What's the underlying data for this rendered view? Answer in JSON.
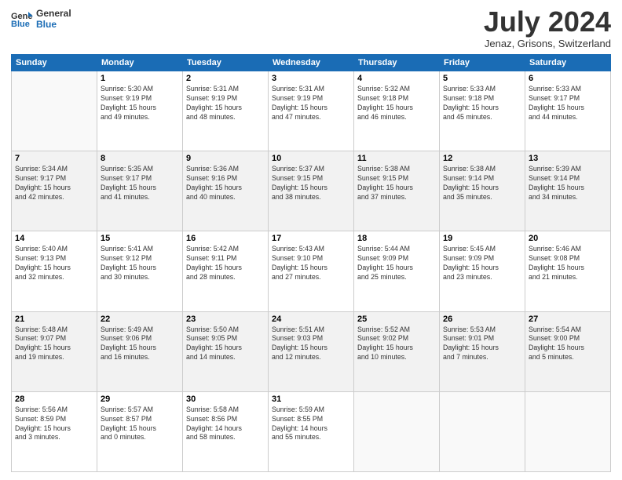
{
  "header": {
    "logo_line1": "General",
    "logo_line2": "Blue",
    "month_year": "July 2024",
    "location": "Jenaz, Grisons, Switzerland"
  },
  "weekdays": [
    "Sunday",
    "Monday",
    "Tuesday",
    "Wednesday",
    "Thursday",
    "Friday",
    "Saturday"
  ],
  "weeks": [
    [
      {
        "day": "",
        "info": ""
      },
      {
        "day": "1",
        "info": "Sunrise: 5:30 AM\nSunset: 9:19 PM\nDaylight: 15 hours\nand 49 minutes."
      },
      {
        "day": "2",
        "info": "Sunrise: 5:31 AM\nSunset: 9:19 PM\nDaylight: 15 hours\nand 48 minutes."
      },
      {
        "day": "3",
        "info": "Sunrise: 5:31 AM\nSunset: 9:19 PM\nDaylight: 15 hours\nand 47 minutes."
      },
      {
        "day": "4",
        "info": "Sunrise: 5:32 AM\nSunset: 9:18 PM\nDaylight: 15 hours\nand 46 minutes."
      },
      {
        "day": "5",
        "info": "Sunrise: 5:33 AM\nSunset: 9:18 PM\nDaylight: 15 hours\nand 45 minutes."
      },
      {
        "day": "6",
        "info": "Sunrise: 5:33 AM\nSunset: 9:17 PM\nDaylight: 15 hours\nand 44 minutes."
      }
    ],
    [
      {
        "day": "7",
        "info": "Sunrise: 5:34 AM\nSunset: 9:17 PM\nDaylight: 15 hours\nand 42 minutes."
      },
      {
        "day": "8",
        "info": "Sunrise: 5:35 AM\nSunset: 9:17 PM\nDaylight: 15 hours\nand 41 minutes."
      },
      {
        "day": "9",
        "info": "Sunrise: 5:36 AM\nSunset: 9:16 PM\nDaylight: 15 hours\nand 40 minutes."
      },
      {
        "day": "10",
        "info": "Sunrise: 5:37 AM\nSunset: 9:15 PM\nDaylight: 15 hours\nand 38 minutes."
      },
      {
        "day": "11",
        "info": "Sunrise: 5:38 AM\nSunset: 9:15 PM\nDaylight: 15 hours\nand 37 minutes."
      },
      {
        "day": "12",
        "info": "Sunrise: 5:38 AM\nSunset: 9:14 PM\nDaylight: 15 hours\nand 35 minutes."
      },
      {
        "day": "13",
        "info": "Sunrise: 5:39 AM\nSunset: 9:14 PM\nDaylight: 15 hours\nand 34 minutes."
      }
    ],
    [
      {
        "day": "14",
        "info": "Sunrise: 5:40 AM\nSunset: 9:13 PM\nDaylight: 15 hours\nand 32 minutes."
      },
      {
        "day": "15",
        "info": "Sunrise: 5:41 AM\nSunset: 9:12 PM\nDaylight: 15 hours\nand 30 minutes."
      },
      {
        "day": "16",
        "info": "Sunrise: 5:42 AM\nSunset: 9:11 PM\nDaylight: 15 hours\nand 28 minutes."
      },
      {
        "day": "17",
        "info": "Sunrise: 5:43 AM\nSunset: 9:10 PM\nDaylight: 15 hours\nand 27 minutes."
      },
      {
        "day": "18",
        "info": "Sunrise: 5:44 AM\nSunset: 9:09 PM\nDaylight: 15 hours\nand 25 minutes."
      },
      {
        "day": "19",
        "info": "Sunrise: 5:45 AM\nSunset: 9:09 PM\nDaylight: 15 hours\nand 23 minutes."
      },
      {
        "day": "20",
        "info": "Sunrise: 5:46 AM\nSunset: 9:08 PM\nDaylight: 15 hours\nand 21 minutes."
      }
    ],
    [
      {
        "day": "21",
        "info": "Sunrise: 5:48 AM\nSunset: 9:07 PM\nDaylight: 15 hours\nand 19 minutes."
      },
      {
        "day": "22",
        "info": "Sunrise: 5:49 AM\nSunset: 9:06 PM\nDaylight: 15 hours\nand 16 minutes."
      },
      {
        "day": "23",
        "info": "Sunrise: 5:50 AM\nSunset: 9:05 PM\nDaylight: 15 hours\nand 14 minutes."
      },
      {
        "day": "24",
        "info": "Sunrise: 5:51 AM\nSunset: 9:03 PM\nDaylight: 15 hours\nand 12 minutes."
      },
      {
        "day": "25",
        "info": "Sunrise: 5:52 AM\nSunset: 9:02 PM\nDaylight: 15 hours\nand 10 minutes."
      },
      {
        "day": "26",
        "info": "Sunrise: 5:53 AM\nSunset: 9:01 PM\nDaylight: 15 hours\nand 7 minutes."
      },
      {
        "day": "27",
        "info": "Sunrise: 5:54 AM\nSunset: 9:00 PM\nDaylight: 15 hours\nand 5 minutes."
      }
    ],
    [
      {
        "day": "28",
        "info": "Sunrise: 5:56 AM\nSunset: 8:59 PM\nDaylight: 15 hours\nand 3 minutes."
      },
      {
        "day": "29",
        "info": "Sunrise: 5:57 AM\nSunset: 8:57 PM\nDaylight: 15 hours\nand 0 minutes."
      },
      {
        "day": "30",
        "info": "Sunrise: 5:58 AM\nSunset: 8:56 PM\nDaylight: 14 hours\nand 58 minutes."
      },
      {
        "day": "31",
        "info": "Sunrise: 5:59 AM\nSunset: 8:55 PM\nDaylight: 14 hours\nand 55 minutes."
      },
      {
        "day": "",
        "info": ""
      },
      {
        "day": "",
        "info": ""
      },
      {
        "day": "",
        "info": ""
      }
    ]
  ]
}
